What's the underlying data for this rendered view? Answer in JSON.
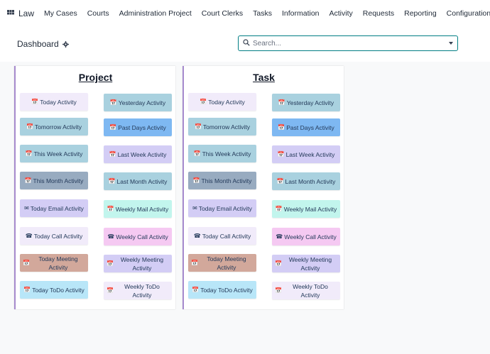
{
  "topbar": {
    "app_name": "Law",
    "menu": [
      "My Cases",
      "Courts",
      "Administration Project",
      "Court Clerks",
      "Tasks",
      "Information",
      "Activity",
      "Requests",
      "Reporting",
      "Configuration"
    ]
  },
  "controlbar": {
    "title": "Dashboard",
    "search_placeholder": "Search..."
  },
  "panels": [
    {
      "title": "Project",
      "tiles": [
        {
          "label": "Today Activity",
          "icon": "calendar-icon",
          "color": "#f1ebfa"
        },
        {
          "label": "Yesterday Activity",
          "icon": "calendar-check-icon",
          "color": "#a9d1df"
        },
        {
          "label": "Tomorrow Activity",
          "icon": "calendar-icon",
          "color": "#a9d1df"
        },
        {
          "label": "Past Days Activity",
          "icon": "calendar-check-icon",
          "color": "#7eb8f2"
        },
        {
          "label": "This Week Activity",
          "icon": "calendar-check-icon",
          "color": "#a9d1df"
        },
        {
          "label": "Last Week Activity",
          "icon": "calendar-check-icon",
          "color": "#d3cdf5"
        },
        {
          "label": "This Month Activity",
          "icon": "calendar-icon",
          "color": "#98abc0"
        },
        {
          "label": "Last Month Activity",
          "icon": "calendar-icon",
          "color": "#a9d1df"
        },
        {
          "label": "Today Email Activity",
          "icon": "envelope-icon",
          "color": "#d3cdf5"
        },
        {
          "label": "Weekly Mail Activity",
          "icon": "calendar-icon",
          "color": "#c2f5ed"
        },
        {
          "label": "Today Call Activity",
          "icon": "phone-icon",
          "color": "#f1ebfa"
        },
        {
          "label": "Weekly Call Activity",
          "icon": "phone-icon",
          "color": "#f5c9f2"
        },
        {
          "label": "Today Meeting Activity",
          "icon": "calendar-icon",
          "color": "#d2a89b"
        },
        {
          "label": "Weekly Meeting Activity",
          "icon": "calendar-icon",
          "color": "#d3cdf5"
        },
        {
          "label": "Today ToDo Activity",
          "icon": "calendar-check-icon",
          "color": "#b8e6f8"
        },
        {
          "label": "Weekly ToDo Activity",
          "icon": "calendar-icon",
          "color": "#f1ebfa"
        }
      ]
    },
    {
      "title": "Task",
      "tiles": [
        {
          "label": "Today Activity",
          "icon": "calendar-icon",
          "color": "#f1ebfa"
        },
        {
          "label": "Yesterday Activity",
          "icon": "calendar-check-icon",
          "color": "#a9d1df"
        },
        {
          "label": "Tomorrow Activity",
          "icon": "calendar-icon",
          "color": "#a9d1df"
        },
        {
          "label": "Past Days Activity",
          "icon": "calendar-check-icon",
          "color": "#7eb8f2"
        },
        {
          "label": "This Week Activity",
          "icon": "calendar-check-icon",
          "color": "#a9d1df"
        },
        {
          "label": "Last Week Activity",
          "icon": "calendar-check-icon",
          "color": "#d3cdf5"
        },
        {
          "label": "This Month Activity",
          "icon": "calendar-icon",
          "color": "#98abc0"
        },
        {
          "label": "Last Month Activity",
          "icon": "calendar-icon",
          "color": "#a9d1df"
        },
        {
          "label": "Today Email Activity",
          "icon": "envelope-icon",
          "color": "#d3cdf5"
        },
        {
          "label": "Weekly Mail Activity",
          "icon": "calendar-icon",
          "color": "#c2f5ed"
        },
        {
          "label": "Today Call Activity",
          "icon": "phone-icon",
          "color": "#f1ebfa"
        },
        {
          "label": "Weekly Call Activity",
          "icon": "phone-icon",
          "color": "#f5c9f2"
        },
        {
          "label": "Today Meeting Activity",
          "icon": "calendar-icon",
          "color": "#d2a89b"
        },
        {
          "label": "Weekly Meeting Activity",
          "icon": "calendar-icon",
          "color": "#d3cdf5"
        },
        {
          "label": "Today ToDo Activity",
          "icon": "calendar-check-icon",
          "color": "#b8e6f8"
        },
        {
          "label": "Weekly ToDo Activity",
          "icon": "calendar-icon",
          "color": "#f1ebfa"
        }
      ]
    }
  ]
}
